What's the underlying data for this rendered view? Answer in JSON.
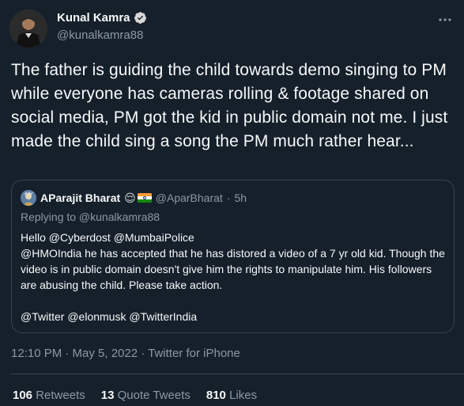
{
  "author": {
    "display_name": "Kunal Kamra",
    "handle": "@kunalkamra88",
    "avatar_icon": "avatar-photo-icon",
    "verified_icon": "verified-badge-icon",
    "verified_color": "#d9d9d9"
  },
  "tweet": {
    "text": "The father is guiding the child towards demo singing to PM while everyone has cameras rolling & footage shared on social media, PM got the kid in public domain not me. I just made the child sing a song the PM much rather hear..."
  },
  "quote": {
    "display_name": "AParajit Bharat",
    "emoji": "😌",
    "flag_icon": "india-flag-icon",
    "handle": "@AparBharat",
    "dot": "·",
    "time": "5h",
    "replying_to": "Replying to @kunalkamra88",
    "body_lines": [
      "Hello @Cyberdost @MumbaiPolice",
      "@HMOIndia he has accepted that he has distored a video of a 7 yr old kid. Though the video is in public domain doesn't give him the rights to manipulate him. His followers are abusing the child. Please take action.",
      "@Twitter @elonmusk @TwitterIndia"
    ]
  },
  "meta": {
    "timestamp": "12:10 PM · May 5, 2022 · Twitter for iPhone"
  },
  "stats": {
    "retweets_count": "106",
    "retweets_label": "Retweets",
    "quotes_count": "13",
    "quotes_label": "Quote Tweets",
    "likes_count": "810",
    "likes_label": "Likes"
  },
  "colors": {
    "background": "#15202b",
    "text_primary": "#f7f9f9",
    "text_secondary": "#8b98a5",
    "border": "#38444d"
  }
}
